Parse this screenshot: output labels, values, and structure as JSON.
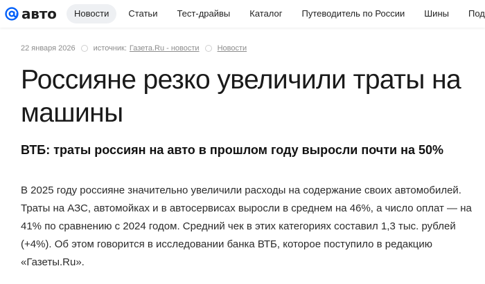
{
  "header": {
    "logo_text": "авто",
    "nav": [
      {
        "label": "Новости",
        "active": true
      },
      {
        "label": "Статьи",
        "active": false
      },
      {
        "label": "Тест-драйвы",
        "active": false
      },
      {
        "label": "Каталог",
        "active": false
      },
      {
        "label": "Путеводитель по России",
        "active": false
      },
      {
        "label": "Шины",
        "active": false
      },
      {
        "label": "Подер",
        "active": false
      }
    ],
    "accent_color": "#005ff9"
  },
  "article": {
    "date": "22 января 2026",
    "source_label": "источник:",
    "source_link": "Газета.Ru - новости",
    "category": "Новости",
    "title": "Россияне резко увеличили траты на машины",
    "subtitle": "ВТБ: траты россиян на авто в прошлом году выросли почти на 50%",
    "body": "В 2025 году россияне значительно увеличили расходы на содержание своих автомобилей. Траты на АЗС, автомойках и в автосервисах выросли в среднем на 46%, а число оплат — на 41% по сравнению с 2024 годом. Средний чек в этих категориях составил 1,3 тыс. рублей (+4%). Об этом говорится в исследовании банка ВТБ, которое поступило в редакцию «Газеты.Ru»."
  }
}
